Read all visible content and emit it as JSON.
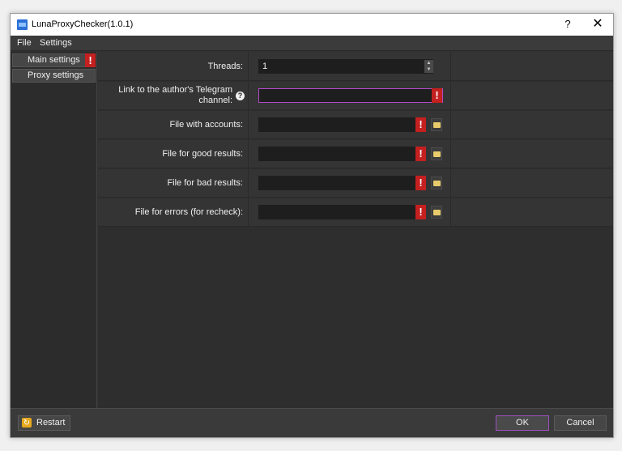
{
  "window": {
    "title": "LunaProxyChecker(1.0.1)",
    "help_label": "?",
    "close_label": "✕"
  },
  "menu": {
    "items": [
      "File",
      "Settings"
    ]
  },
  "sidebar": {
    "items": [
      {
        "label": "Main settings",
        "error": "!"
      },
      {
        "label": "Proxy settings"
      }
    ]
  },
  "form": {
    "rows": [
      {
        "label": "Threads:",
        "value": "1",
        "control": "spinbox"
      },
      {
        "label": "Link to the author's Telegram channel:",
        "value": "",
        "control": "text",
        "help": "?",
        "error": "!"
      },
      {
        "label": "File with accounts:",
        "value": "",
        "control": "file",
        "error": "!"
      },
      {
        "label": "File for good results:",
        "value": "",
        "control": "file",
        "error": "!"
      },
      {
        "label": "File for bad results:",
        "value": "",
        "control": "file",
        "error": "!"
      },
      {
        "label": "File for errors (for recheck):",
        "value": "",
        "control": "file",
        "error": "!"
      }
    ]
  },
  "buttons": {
    "restart": "Restart",
    "ok": "OK",
    "cancel": "Cancel"
  },
  "icons": {
    "app": "luna-proxy-app-icon",
    "help": "question-circle-icon",
    "error": "exclamation-icon",
    "browse": "folder-icon",
    "restart": "restart-icon",
    "spin_up": "arrow-up-icon",
    "spin_down": "arrow-down-icon"
  },
  "colors": {
    "error": "#c42020",
    "accent": "#a050c0",
    "folder": "#e8cc6b",
    "restart": "#e6a81c"
  }
}
